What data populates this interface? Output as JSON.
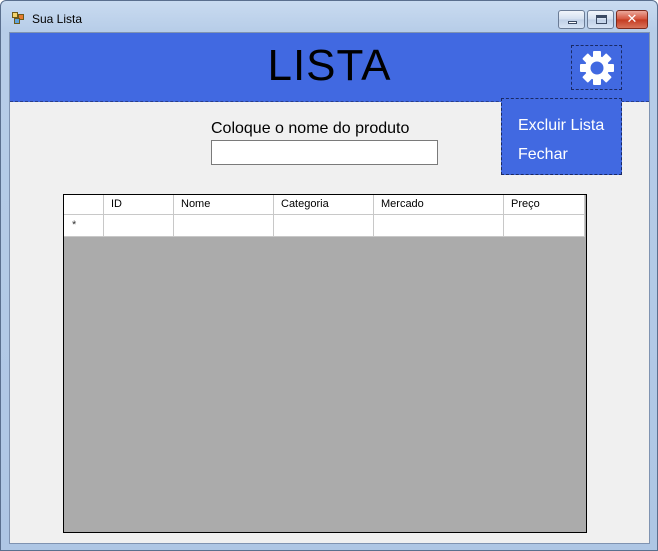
{
  "window": {
    "title": "Sua Lista",
    "buttons": {
      "minimize": "minimize",
      "maximize": "maximize",
      "close": "✕"
    }
  },
  "header": {
    "title": "LISTA",
    "settings_icon": "gear-icon",
    "color": "#4169e1"
  },
  "menu": {
    "items": [
      {
        "label": "Excluir Lista"
      },
      {
        "label": "Fechar"
      }
    ]
  },
  "form": {
    "prompt": "Coloque o nome do produto",
    "value": ""
  },
  "grid": {
    "columns": [
      "ID",
      "Nome",
      "Categoria",
      "Mercado",
      "Preço"
    ],
    "new_row_marker": "*",
    "rows": [],
    "background": "#ababab"
  }
}
